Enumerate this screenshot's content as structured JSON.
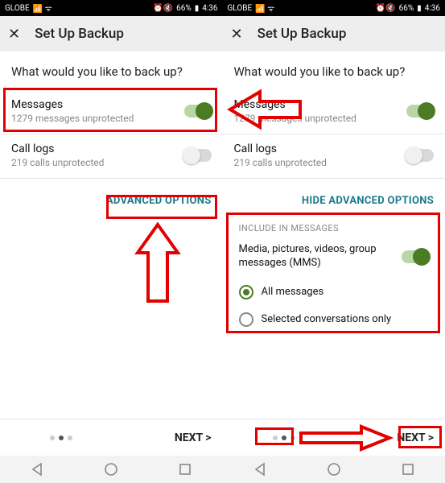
{
  "statusbar": {
    "carrier": "GLOBE",
    "battery": "66%",
    "time": "4:36"
  },
  "header": {
    "title": "Set Up Backup"
  },
  "question": "What would you like to back up?",
  "items": {
    "messages": {
      "label": "Messages",
      "sub": "1279 messages unprotected"
    },
    "calls": {
      "label": "Call logs",
      "sub": "219 calls unprotected"
    }
  },
  "adv_link_left": "ADVANCED OPTIONS",
  "adv_link_right": "HIDE ADVANCED OPTIONS",
  "advanced": {
    "header": "INCLUDE IN MESSAGES",
    "media": "Media, pictures, videos, group messages (MMS)",
    "opt_all": "All messages",
    "opt_sel": "Selected conversations only"
  },
  "footer": {
    "next": "NEXT >"
  }
}
